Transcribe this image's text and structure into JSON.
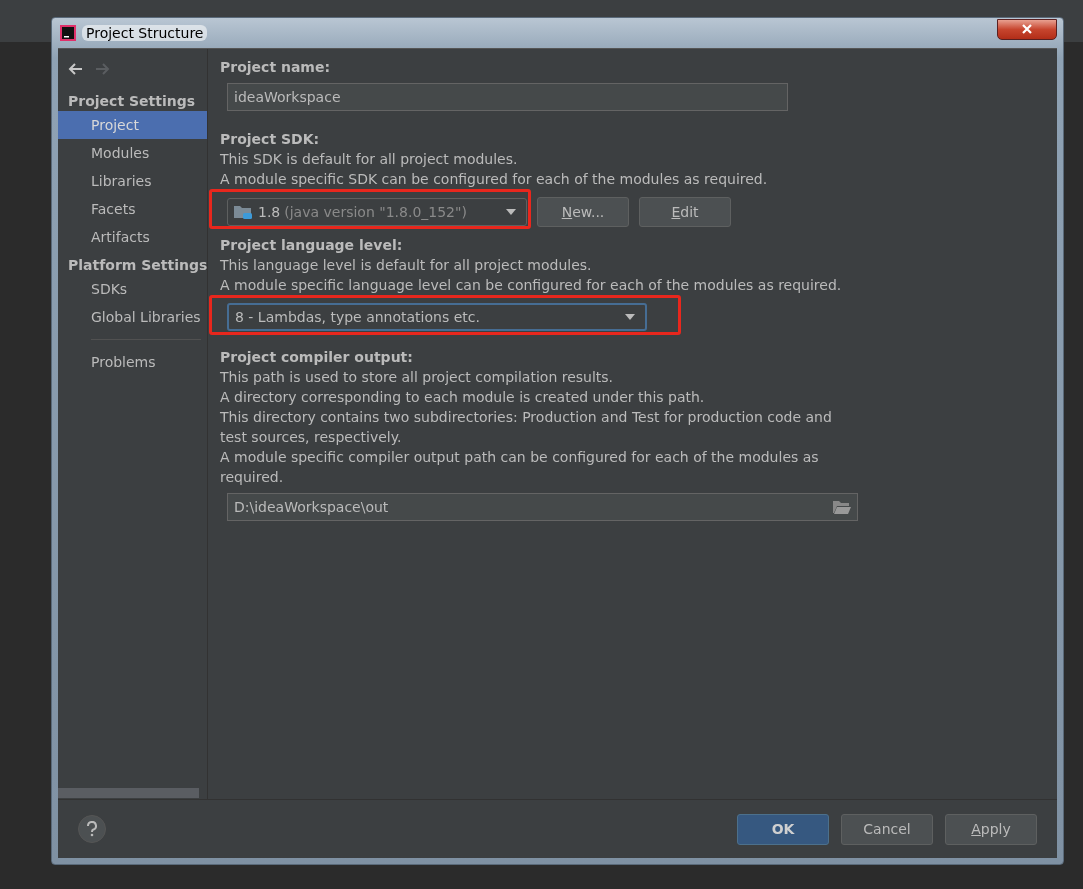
{
  "window": {
    "title": "Project Structure"
  },
  "nav_buttons": [
    {
      "kind": "back",
      "disabled": false
    },
    {
      "kind": "forward",
      "disabled": true
    }
  ],
  "sidebar": {
    "sections": [
      {
        "title": "Project Settings",
        "items": [
          {
            "label": "Project",
            "selected": true
          },
          {
            "label": "Modules",
            "selected": false
          },
          {
            "label": "Libraries",
            "selected": false
          },
          {
            "label": "Facets",
            "selected": false
          },
          {
            "label": "Artifacts",
            "selected": false
          }
        ]
      },
      {
        "title": "Platform Settings",
        "items": [
          {
            "label": "SDKs",
            "selected": false
          },
          {
            "label": "Global Libraries",
            "selected": false
          }
        ]
      },
      {
        "items": [
          {
            "label": "Problems",
            "selected": false
          }
        ]
      }
    ]
  },
  "project_name": {
    "label": "Project name:",
    "value": "ideaWorkspace"
  },
  "project_sdk": {
    "label": "Project SDK:",
    "description": [
      "This SDK is default for all project modules.",
      "A module specific SDK can be configured for each of the modules as required."
    ],
    "combo": {
      "value": "1.8",
      "detail": "(java version \"1.8.0_152\")",
      "focused": false
    },
    "buttons": [
      {
        "label": "New...",
        "underline_first": true
      },
      {
        "label": "Edit",
        "underline_first": true
      }
    ],
    "highlighted": true
  },
  "language_level": {
    "label": "Project language level:",
    "description": [
      "This language level is default for all project modules.",
      "A module specific language level can be configured for each of the modules as required."
    ],
    "combo": {
      "value": "8 - Lambdas, type annotations etc.",
      "focused": true
    },
    "highlighted": true
  },
  "compiler_output": {
    "label": "Project compiler output:",
    "description": [
      "This path is used to store all project compilation results.",
      "A directory corresponding to each module is created under this path.",
      "This directory contains two subdirectories: Production and Test for production code and test sources, respectively.",
      "A module specific compiler output path can be configured for each of the modules as required."
    ],
    "value": "D:\\ideaWorkspace\\out"
  },
  "footer": {
    "buttons": [
      {
        "label": "OK",
        "kind": "primary",
        "underline_first": false
      },
      {
        "label": "Cancel",
        "kind": "normal",
        "underline_first": false
      },
      {
        "label": "Apply",
        "kind": "normal",
        "underline_first": true
      }
    ]
  }
}
